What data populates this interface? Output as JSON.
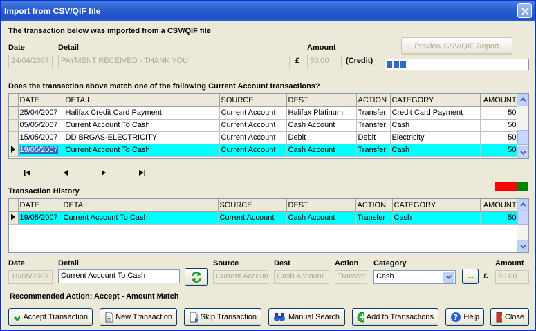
{
  "window": {
    "title": "Import from CSV/QIF file"
  },
  "intro": "The transaction below was imported from a CSV/QIF file",
  "imported": {
    "date_label": "Date",
    "date": "24/04/2007",
    "detail_label": "Detail",
    "detail": "PAYMENT RECEIVED - THANK YOU",
    "amount_label": "Amount",
    "currency": "£",
    "amount": "50.00",
    "credit": "(Credit)"
  },
  "preview_button": "Preview CSV/QIF Report",
  "progress": {
    "filled_blocks": 3,
    "total_blocks": 30,
    "color": "#316ac5"
  },
  "match_question": "Does the transaction above match one of the following Current Account transactions?",
  "match_table": {
    "columns": [
      "DATE",
      "DETAIL",
      "SOURCE",
      "DEST",
      "ACTION",
      "CATEGORY",
      "AMOUNT"
    ],
    "rows": [
      [
        "25/04/2007",
        "Halifax Credit Card Payment",
        "Current Account",
        "Halifax Platinum",
        "Transfer",
        "Credit Card Payment",
        "50"
      ],
      [
        "05/05/2007",
        "Current Account To Cash",
        "Current Account",
        "Cash Account",
        "Transfer",
        "Cash",
        "50"
      ],
      [
        "15/05/2007",
        "DD BRGAS-ELECTRICITY",
        "Current Account",
        "Debit",
        "Debit",
        "Electricity",
        "50"
      ],
      [
        "19/05/2007",
        "Current Account To Cash",
        "Current Account",
        "Cash Account",
        "Transfer",
        "Cash",
        "50"
      ]
    ],
    "selected_row": 3
  },
  "nav": {
    "first": "|◀",
    "prev": "◀",
    "next": "▶",
    "last": "▶|"
  },
  "history_label": "Transaction History",
  "status_colors": [
    "#ff0000",
    "#ff0000",
    "#008000"
  ],
  "history_table": {
    "columns": [
      "DATE",
      "DETAIL",
      "SOURCE",
      "DEST",
      "ACTION",
      "CATEGORY",
      "AMOUNT"
    ],
    "rows": [
      [
        "19/05/2007",
        "Current Account To Cash",
        "Current Account",
        "Cash Account",
        "Transfer",
        "Cash",
        "50"
      ]
    ],
    "selected_row": 0
  },
  "edit": {
    "date_label": "Date",
    "date": "19/05/2007",
    "detail_label": "Detail",
    "detail": "Current Account To Cash",
    "source_label": "Source",
    "source": "Current Accoun",
    "dest_label": "Dest",
    "dest": "Cash Account",
    "action_label": "Action",
    "action": "Transfer",
    "category_label": "Category",
    "category": "Cash",
    "more": "...",
    "amount_label": "Amount",
    "currency": "£",
    "amount": "50.00"
  },
  "recommended": "Recommended Action: Accept - Amount Match",
  "buttons": {
    "accept": "Accept Transaction",
    "new": "New Transaction",
    "skip": "Skip Transaction",
    "manual": "Manual Search",
    "add": "Add to Transactions",
    "help": "Help",
    "close": "Close"
  }
}
